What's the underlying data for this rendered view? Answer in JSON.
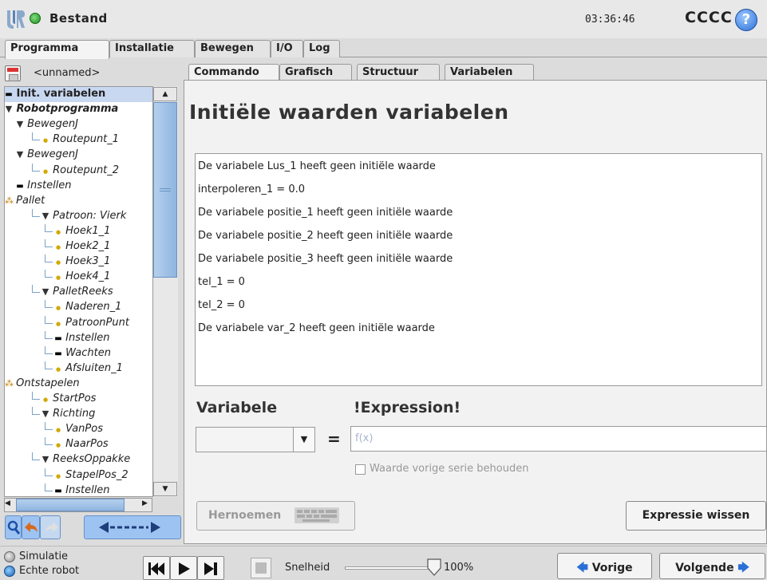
{
  "header": {
    "app_title": "Bestand",
    "clock": "03:36:46",
    "robot_name": "CCCC",
    "help_label": "?"
  },
  "main_tabs": [
    {
      "label": "Programma",
      "active": true
    },
    {
      "label": "Installatie",
      "active": false
    },
    {
      "label": "Bewegen",
      "active": false
    },
    {
      "label": "I/O",
      "active": false
    },
    {
      "label": "Log",
      "active": false
    }
  ],
  "program": {
    "name": "<unnamed>"
  },
  "tree": [
    {
      "label": "Init. variabelen",
      "indent": 0,
      "kind": "set",
      "selected": true
    },
    {
      "label": "Robotprogramma",
      "indent": 0,
      "kind": "tri",
      "bold": true
    },
    {
      "label": "BewegenJ",
      "indent": 1,
      "kind": "tri"
    },
    {
      "label": "Routepunt_1",
      "indent": 2,
      "kind": "wp"
    },
    {
      "label": "BewegenJ",
      "indent": 1,
      "kind": "tri"
    },
    {
      "label": "Routepunt_2",
      "indent": 2,
      "kind": "wp"
    },
    {
      "label": "Instellen",
      "indent": 1,
      "kind": "set"
    },
    {
      "label": "Pallet",
      "indent": 0,
      "kind": "pal"
    },
    {
      "label": "Patroon: Vierk",
      "indent": 2,
      "kind": "tri"
    },
    {
      "label": "Hoek1_1",
      "indent": 3,
      "kind": "wp"
    },
    {
      "label": "Hoek2_1",
      "indent": 3,
      "kind": "wp"
    },
    {
      "label": "Hoek3_1",
      "indent": 3,
      "kind": "wp"
    },
    {
      "label": "Hoek4_1",
      "indent": 3,
      "kind": "wp"
    },
    {
      "label": "PalletReeks",
      "indent": 2,
      "kind": "tri"
    },
    {
      "label": "Naderen_1",
      "indent": 3,
      "kind": "wp"
    },
    {
      "label": "PatroonPunt",
      "indent": 3,
      "kind": "wp"
    },
    {
      "label": "Instellen",
      "indent": 3,
      "kind": "set"
    },
    {
      "label": "Wachten",
      "indent": 3,
      "kind": "set"
    },
    {
      "label": "Afsluiten_1",
      "indent": 3,
      "kind": "wp"
    },
    {
      "label": "Ontstapelen",
      "indent": 0,
      "kind": "pal"
    },
    {
      "label": "StartPos",
      "indent": 2,
      "kind": "wp"
    },
    {
      "label": "Richting",
      "indent": 2,
      "kind": "tri"
    },
    {
      "label": "VanPos",
      "indent": 3,
      "kind": "wp"
    },
    {
      "label": "NaarPos",
      "indent": 3,
      "kind": "wp"
    },
    {
      "label": "ReeksOppakke",
      "indent": 2,
      "kind": "tri"
    },
    {
      "label": "StapelPos_2",
      "indent": 3,
      "kind": "wp"
    },
    {
      "label": "Instellen",
      "indent": 3,
      "kind": "set"
    }
  ],
  "content_tabs": [
    {
      "label": "Commando",
      "active": true
    },
    {
      "label": "Grafisch",
      "active": false
    },
    {
      "label": "Structuur",
      "active": false
    },
    {
      "label": "Variabelen",
      "active": false
    }
  ],
  "page_title": "Initiële waarden variabelen",
  "variables": [
    "De variabele Lus_1 heeft geen initiële waarde",
    "interpoleren_1 = 0.0",
    "De variabele positie_1 heeft geen initiële waarde",
    "De variabele positie_2 heeft geen initiële waarde",
    "De variabele positie_3 heeft geen initiële waarde",
    "tel_1 = 0",
    "tel_2 = 0",
    "De variabele var_2 heeft geen initiële waarde"
  ],
  "editor": {
    "variable_label": "Variabele",
    "expression_label": "!Expression!",
    "equals": "=",
    "expression_placeholder": "f(x)",
    "keep_value_label": "Waarde vorige serie behouden",
    "keep_value_checked": false,
    "rename_label": "Hernoemen",
    "clear_label": "Expressie wissen"
  },
  "footer": {
    "simulation_label": "Simulatie",
    "real_robot_label": "Echte robot",
    "speed_label": "Snelheid",
    "speed_value": "100%",
    "speed_fraction": 1.0,
    "prev_label": "Vorige",
    "next_label": "Volgende"
  },
  "colors": {
    "accent": "#2a6fd6",
    "selection": "#c8d8f0",
    "waypoint": "#d4a800"
  }
}
